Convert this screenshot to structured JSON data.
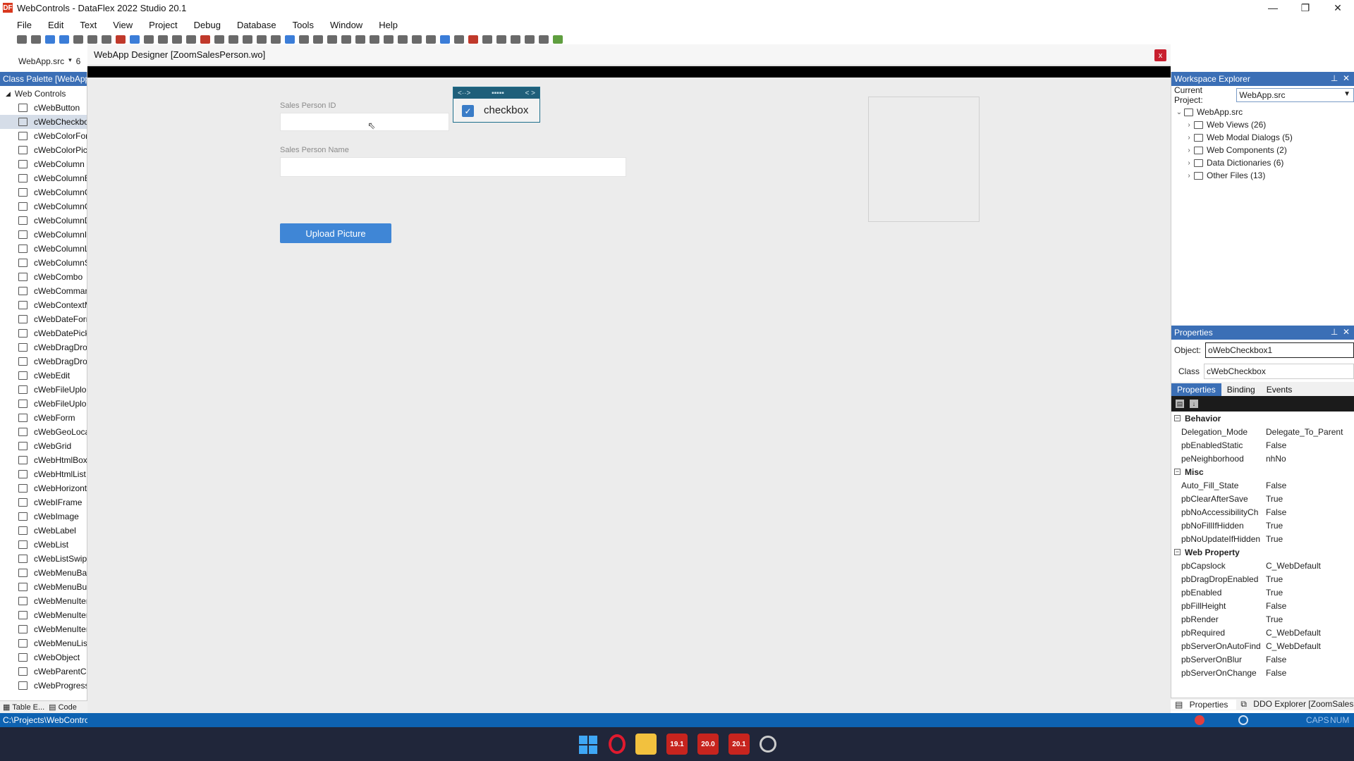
{
  "window": {
    "title": "WebControls - DataFlex 2022 Studio 20.1",
    "app_icon": "DF"
  },
  "menu": [
    "File",
    "Edit",
    "Text",
    "View",
    "Project",
    "Debug",
    "Database",
    "Tools",
    "Window",
    "Help"
  ],
  "toolbar2": {
    "project_combo": "WebApp.src",
    "trunc": "6"
  },
  "designer": {
    "title": "WebApp Designer [ZoomSalesPerson.wo]",
    "close": "x",
    "fields": [
      {
        "label": "Sales Person ID",
        "value": ""
      },
      {
        "label": "Sales Person Name",
        "value": ""
      }
    ],
    "upload_button": "Upload Picture",
    "checkbox": {
      "label": "checkbox",
      "checked": true,
      "handle_left": "<··>",
      "handle_mid": "▪▪▪▪▪",
      "handle_right": "< >"
    }
  },
  "palette": {
    "title": "Class Palette [WebApp",
    "group": "Web Controls",
    "items": [
      "cWebButton",
      "cWebCheckbox",
      "cWebColorForm",
      "cWebColorPicker",
      "cWebColumn",
      "cWebColumnButton",
      "cWebColumnCheckbox",
      "cWebColumnCombo",
      "cWebColumnDate",
      "cWebColumnImage",
      "cWebColumnLink",
      "cWebColumnSuggestion",
      "cWebCombo",
      "cWebCommandBar",
      "cWebContextMenu",
      "cWebDateForm",
      "cWebDatePicker",
      "cWebDragDropFileHelper",
      "cWebDragDropHelper",
      "cWebEdit",
      "cWebFileUploadButton",
      "cWebFileUploadForm",
      "cWebForm",
      "cWebGeoLocation",
      "cWebGrid",
      "cWebHtmlBox",
      "cWebHtmlList",
      "cWebHorizontalLine",
      "cWebIFrame",
      "cWebImage",
      "cWebLabel",
      "cWebList",
      "cWebListSwipeButton",
      "cWebMenuBar",
      "cWebMenuButton",
      "cWebMenuItem",
      "cWebMenuItemCheckbox",
      "cWebMenuItemLink",
      "cWebMenuList",
      "cWebObject",
      "cWebParentCombo",
      "cWebProgressBar"
    ],
    "selected_index": 1,
    "bottom_tabs": [
      "Table E...",
      "Code"
    ]
  },
  "workspace": {
    "title": "Workspace Explorer",
    "current_project_label": "Current Project:",
    "current_project": "WebApp.src",
    "root": "WebApp.src",
    "nodes": [
      "Web Views (26)",
      "Web Modal Dialogs (5)",
      "Web Components (2)",
      "Data Dictionaries (6)",
      "Other Files (13)"
    ]
  },
  "properties": {
    "title": "Properties",
    "object_label": "Object:",
    "object_value": "oWebCheckbox1",
    "class_label": "Class",
    "class_value": "cWebCheckbox",
    "tabs": [
      "Properties",
      "Binding",
      "Events"
    ],
    "categories": [
      {
        "name": "Behavior",
        "rows": [
          [
            "Delegation_Mode",
            "Delegate_To_Parent"
          ],
          [
            "pbEnabledStatic",
            "False"
          ],
          [
            "peNeighborhood",
            "nhNo"
          ]
        ]
      },
      {
        "name": "Misc",
        "rows": [
          [
            "Auto_Fill_State",
            "False"
          ],
          [
            "pbClearAfterSave",
            "True"
          ],
          [
            "pbNoAccessibilityCh",
            "False"
          ],
          [
            "pbNoFillIfHidden",
            "True"
          ],
          [
            "pbNoUpdateIfHidden",
            "True"
          ]
        ]
      },
      {
        "name": "Web Property",
        "rows": [
          [
            "pbCapslock",
            "C_WebDefault"
          ],
          [
            "pbDragDropEnabled",
            "True"
          ],
          [
            "pbEnabled",
            "True"
          ],
          [
            "pbFillHeight",
            "False"
          ],
          [
            "pbRender",
            "True"
          ],
          [
            "pbRequired",
            "C_WebDefault"
          ],
          [
            "pbServerOnAutoFind",
            "C_WebDefault"
          ],
          [
            "pbServerOnBlur",
            "False"
          ],
          [
            "pbServerOnChange",
            "False"
          ]
        ]
      }
    ],
    "bottom_tabs": [
      "Properties",
      "DDO Explorer [ZoomSalesPe..."
    ]
  },
  "statusbar": {
    "path": "C:\\Projects\\WebControls",
    "caps": "CAPS",
    "num": "NUM"
  },
  "taskbar": [
    "19.1",
    "20.0",
    "20.1"
  ]
}
